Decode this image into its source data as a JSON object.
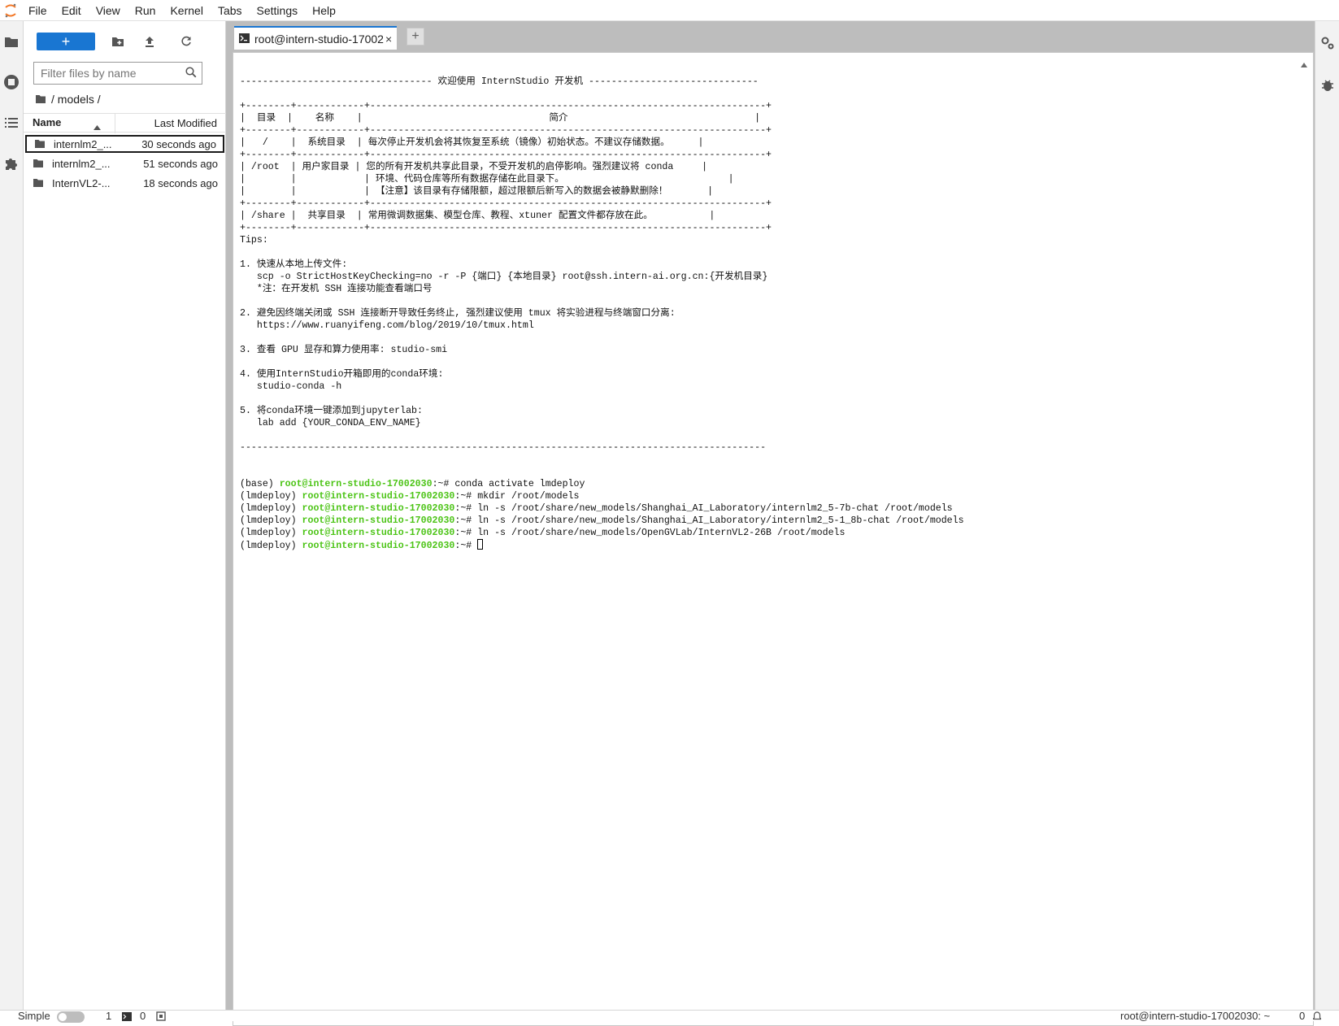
{
  "menubar": {
    "items": [
      "File",
      "Edit",
      "View",
      "Run",
      "Kernel",
      "Tabs",
      "Settings",
      "Help"
    ]
  },
  "leftbar": {
    "icons": [
      "folder-icon",
      "running-icon",
      "toc-icon",
      "extension-icon"
    ]
  },
  "filebrowser": {
    "new_label": "+",
    "filter_placeholder": "Filter files by name",
    "breadcrumb": "/ models /",
    "col_name": "Name",
    "col_modified": "Last Modified",
    "files": [
      {
        "name": "internlm2_...",
        "modified": "30 seconds ago"
      },
      {
        "name": "internlm2_...",
        "modified": "51 seconds ago"
      },
      {
        "name": "InternVL2-...",
        "modified": "18 seconds ago"
      }
    ]
  },
  "tab": {
    "title": "root@intern-studio-17002",
    "close": "×",
    "add": "+"
  },
  "terminal": {
    "lines": [
      "---------------------------------- 欢迎使用 InternStudio 开发机 ------------------------------",
      "",
      "+--------+------------+----------------------------------------------------------------------+",
      "|  目录  |    名称    |                                 简介                                 |",
      "+--------+------------+----------------------------------------------------------------------+",
      "|   /    |  系统目录  | 每次停止开发机会将其恢复至系统（镜像）初始状态。不建议存储数据。     |",
      "+--------+------------+----------------------------------------------------------------------+",
      "| /root  | 用户家目录 | 您的所有开发机共享此目录，不受开发机的启停影响。强烈建议将 conda     |",
      "|        |            | 环境、代码仓库等所有数据存储在此目录下。                             |",
      "|        |            | 【注意】该目录有存储限额，超过限额后新写入的数据会被静默删除！       |",
      "+--------+------------+----------------------------------------------------------------------+",
      "| /share |  共享目录  | 常用微调数据集、模型仓库、教程、xtuner 配置文件都存放在此。          |",
      "+--------+------------+----------------------------------------------------------------------+",
      "Tips:",
      "",
      "1. 快速从本地上传文件:",
      "   scp -o StrictHostKeyChecking=no -r -P {端口} {本地目录} root@ssh.intern-ai.org.cn:{开发机目录}",
      "   *注：在开发机 SSH 连接功能查看端口号",
      "",
      "2. 避免因终端关闭或 SSH 连接断开导致任务终止, 强烈建议使用 tmux 将实验进程与终端窗口分离:",
      "   https://www.ruanyifeng.com/blog/2019/10/tmux.html",
      "",
      "3. 查看 GPU 显存和算力使用率: studio-smi",
      "",
      "4. 使用InternStudio开箱即用的conda环境:",
      "   studio-conda -h",
      "",
      "5. 将conda环境一键添加到jupyterlab:",
      "   lab add {YOUR_CONDA_ENV_NAME}",
      "",
      "---------------------------------------------------------------------------------------------",
      "",
      ""
    ],
    "prompt_host": "root@intern-studio-17002030",
    "commands": [
      {
        "env": "(base)",
        "path": ":~#",
        "cmd": " conda activate lmdeploy"
      },
      {
        "env": "(lmdeploy)",
        "path": ":~#",
        "cmd": " mkdir /root/models"
      },
      {
        "env": "(lmdeploy)",
        "path": ":~#",
        "cmd": " ln -s /root/share/new_models/Shanghai_AI_Laboratory/internlm2_5-7b-chat /root/models"
      },
      {
        "env": "(lmdeploy)",
        "path": ":~#",
        "cmd": " ln -s /root/share/new_models/Shanghai_AI_Laboratory/internlm2_5-1_8b-chat /root/models"
      },
      {
        "env": "(lmdeploy)",
        "path": ":~#",
        "cmd": " ln -s /root/share/new_models/OpenGVLab/InternVL2-26B /root/models"
      },
      {
        "env": "(lmdeploy)",
        "path": ":~#",
        "cmd": " "
      }
    ]
  },
  "statusbar": {
    "mode": "Simple",
    "kernels": "1",
    "terminals": "0",
    "right_text": "root@intern-studio-17002030: ~",
    "right_count": "0"
  },
  "colors": {
    "accent": "#1976d2",
    "prompt_green": "#4cc416",
    "panel_bg": "#bdbdbd"
  }
}
